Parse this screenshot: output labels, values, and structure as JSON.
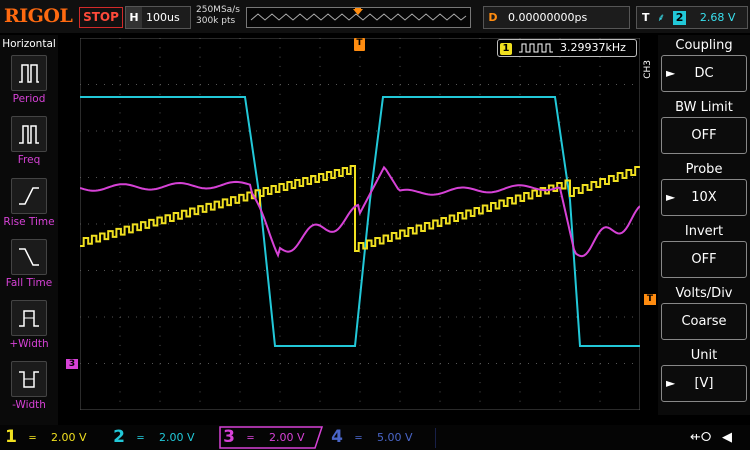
{
  "header": {
    "brand": "RIGOL",
    "run_state": "STOP",
    "timebase_key": "H",
    "timebase_value": "100us",
    "sample_rate": "250MSa/s",
    "memory_depth": "300k pts",
    "delay_key": "D",
    "delay_value": "0.00000000ps",
    "trigger_key": "T",
    "trigger_source": "2",
    "trigger_level": "2.68 V"
  },
  "left_menu": {
    "title": "Horizontal",
    "items": [
      {
        "label": "Period",
        "icon": "period-icon"
      },
      {
        "label": "Freq",
        "icon": "frequency-icon"
      },
      {
        "label": "Rise Time",
        "icon": "rise-time-icon"
      },
      {
        "label": "Fall Time",
        "icon": "fall-time-icon"
      },
      {
        "label": "+Width",
        "icon": "positive-width-icon"
      },
      {
        "label": "-Width",
        "icon": "negative-width-icon"
      }
    ]
  },
  "right_menu": {
    "channel_tag": "CH3",
    "items": [
      {
        "title": "Coupling",
        "value": "DC",
        "has_arrow": true
      },
      {
        "title": "BW Limit",
        "value": "OFF",
        "has_arrow": false
      },
      {
        "title": "Probe",
        "value": "10X",
        "has_arrow": true
      },
      {
        "title": "Invert",
        "value": "OFF",
        "has_arrow": false
      },
      {
        "title": "Volts/Div",
        "value": "Coarse",
        "has_arrow": false
      },
      {
        "title": "Unit",
        "value": "[V]",
        "has_arrow": true
      }
    ]
  },
  "measurement": {
    "channel": "1",
    "value": "3.29937kHz"
  },
  "markers": {
    "trigger_time": "T",
    "trigger_level": "T",
    "ch3_ref": "3"
  },
  "channels": [
    {
      "num": "1",
      "coupling": "═",
      "scale": "2.00 V",
      "color": "#f0e020",
      "active": false
    },
    {
      "num": "2",
      "coupling": "═",
      "scale": "2.00 V",
      "color": "#22c8d8",
      "active": false
    },
    {
      "num": "3",
      "coupling": "═",
      "scale": "2.00 V",
      "color": "#d642d6",
      "active": true
    },
    {
      "num": "4",
      "coupling": "═",
      "scale": "5.00 V",
      "color": "#4a66c8",
      "active": false
    }
  ],
  "status": {
    "usb_icon": "usb-icon",
    "speaker_icon": "speaker-icon"
  },
  "colors": {
    "ch1": "#f0e020",
    "ch2": "#22c8d8",
    "ch3": "#d642d6",
    "ch4": "#4a66c8",
    "accent": "#ff8c10",
    "stop_red": "#ff4a3a"
  }
}
